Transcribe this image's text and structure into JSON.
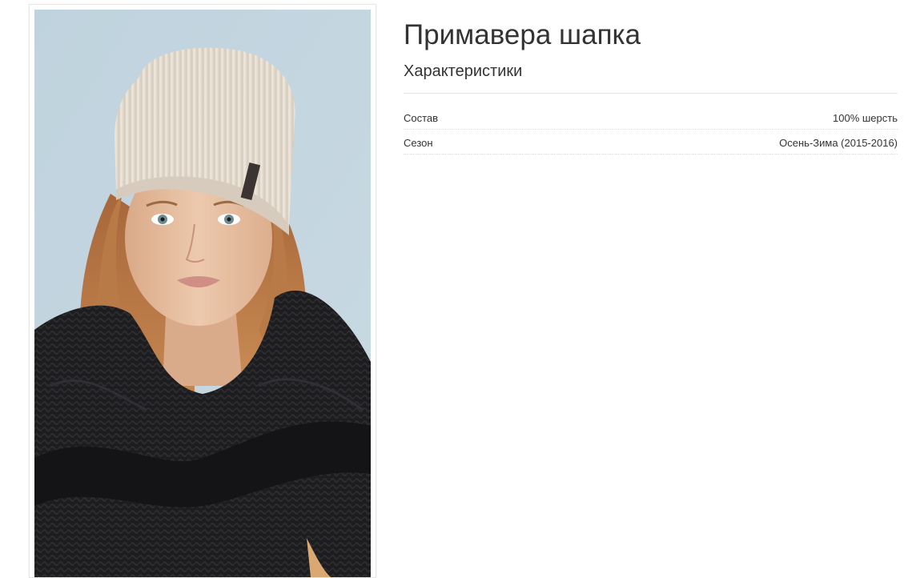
{
  "product": {
    "title": "Примавера шапка",
    "image_alt": "hat-photo"
  },
  "characteristics": {
    "heading": "Характеристики",
    "rows": [
      {
        "name": "Состав",
        "value": "100% шерсть"
      },
      {
        "name": "Сезон",
        "value": "Осень-Зима (2015-2016)"
      }
    ]
  },
  "colors": {
    "photo_background": "#c4d6e0",
    "hat": "#e9e1d6",
    "scarf": "#1c1c1e",
    "hair": "#b8743f",
    "skin": "#e7bfa2"
  }
}
